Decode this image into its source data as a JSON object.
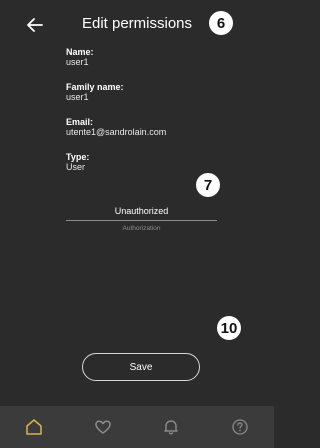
{
  "header": {
    "title": "Edit permissions"
  },
  "markers": {
    "m1": "6",
    "m2": "7",
    "m3": "10"
  },
  "fields": [
    {
      "label": "Name",
      "value": "user1"
    },
    {
      "label": "Family name",
      "value": "user1"
    },
    {
      "label": "Email",
      "value": "utente1@sandrolain.com"
    },
    {
      "label": "Type",
      "value": "User"
    }
  ],
  "authorization": {
    "value": "Unauthorized",
    "hint": "Authorization"
  },
  "actions": {
    "save_label": "Save"
  },
  "tabs": [
    {
      "icon": "home-icon",
      "active": true
    },
    {
      "icon": "heart-icon",
      "active": false
    },
    {
      "icon": "bell-icon",
      "active": false
    },
    {
      "icon": "help-icon",
      "active": false
    }
  ],
  "colors": {
    "accent": "#d9b44a",
    "background": "#2b2b2b",
    "tabbar": "#3b3b3b",
    "inactive_icon": "#8a8a8a"
  }
}
